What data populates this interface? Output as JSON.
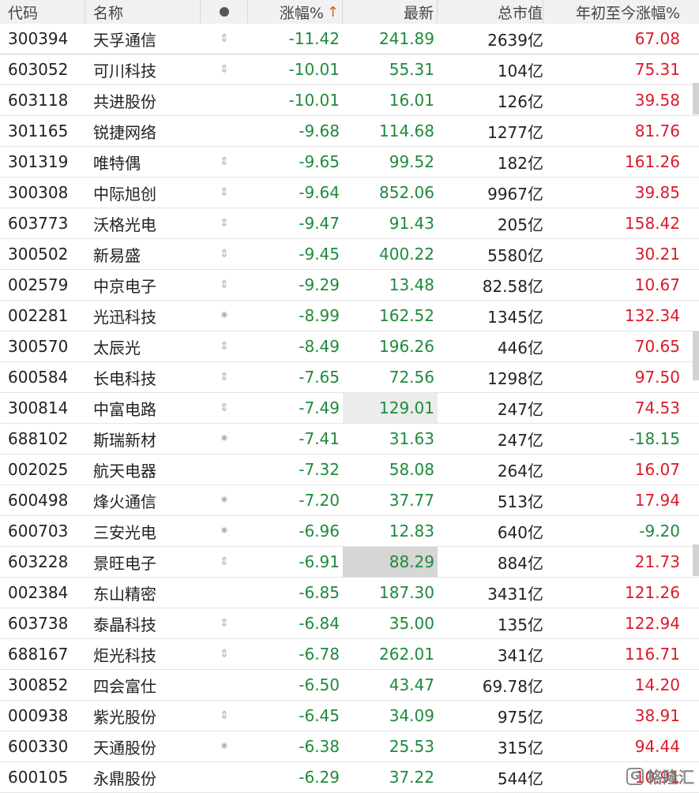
{
  "header": {
    "code": "代码",
    "name": "名称",
    "pct": "涨幅%",
    "pct_sort_arrow": "↑",
    "last": "最新",
    "cap": "总市值",
    "ytd": "年初至今涨幅%"
  },
  "colors": {
    "down": "#1e8a3a",
    "up": "#d91b2a",
    "sort_arrow": "#e0572a"
  },
  "rows": [
    {
      "code": "300394",
      "name": "天孚通信",
      "flag": "⇕",
      "pct": "-11.42",
      "last": "241.89",
      "cap": "2639亿",
      "ytd": "67.08"
    },
    {
      "code": "603052",
      "name": "可川科技",
      "flag": "⇕",
      "pct": "-10.01",
      "last": "55.31",
      "cap": "104亿",
      "ytd": "75.31"
    },
    {
      "code": "603118",
      "name": "共进股份",
      "flag": "",
      "pct": "-10.01",
      "last": "16.01",
      "cap": "126亿",
      "ytd": "39.58"
    },
    {
      "code": "301165",
      "name": "锐捷网络",
      "flag": "",
      "pct": "-9.68",
      "last": "114.68",
      "cap": "1277亿",
      "ytd": "81.76"
    },
    {
      "code": "301319",
      "name": "唯特偶",
      "flag": "⇕",
      "pct": "-9.65",
      "last": "99.52",
      "cap": "182亿",
      "ytd": "161.26"
    },
    {
      "code": "300308",
      "name": "中际旭创",
      "flag": "⇕",
      "pct": "-9.64",
      "last": "852.06",
      "cap": "9967亿",
      "ytd": "39.85"
    },
    {
      "code": "603773",
      "name": "沃格光电",
      "flag": "⇕",
      "pct": "-9.47",
      "last": "91.43",
      "cap": "205亿",
      "ytd": "158.42"
    },
    {
      "code": "300502",
      "name": "新易盛",
      "flag": "⇕",
      "pct": "-9.45",
      "last": "400.22",
      "cap": "5580亿",
      "ytd": "30.21"
    },
    {
      "code": "002579",
      "name": "中京电子",
      "flag": "⇕",
      "pct": "-9.29",
      "last": "13.48",
      "cap": "82.58亿",
      "ytd": "10.67"
    },
    {
      "code": "002281",
      "name": "光迅科技",
      "flag": "✷",
      "pct": "-8.99",
      "last": "162.52",
      "cap": "1345亿",
      "ytd": "132.34"
    },
    {
      "code": "300570",
      "name": "太辰光",
      "flag": "⇕",
      "pct": "-8.49",
      "last": "196.26",
      "cap": "446亿",
      "ytd": "70.65"
    },
    {
      "code": "600584",
      "name": "长电科技",
      "flag": "⇕",
      "pct": "-7.65",
      "last": "72.56",
      "cap": "1298亿",
      "ytd": "97.50"
    },
    {
      "code": "300814",
      "name": "中富电路",
      "flag": "⇕",
      "pct": "-7.49",
      "last": "129.01",
      "cap": "247亿",
      "ytd": "74.53"
    },
    {
      "code": "688102",
      "name": "斯瑞新材",
      "flag": "✷",
      "pct": "-7.41",
      "last": "31.63",
      "cap": "247亿",
      "ytd": "-18.15"
    },
    {
      "code": "002025",
      "name": "航天电器",
      "flag": "",
      "pct": "-7.32",
      "last": "58.08",
      "cap": "264亿",
      "ytd": "16.07"
    },
    {
      "code": "600498",
      "name": "烽火通信",
      "flag": "✷",
      "pct": "-7.20",
      "last": "37.77",
      "cap": "513亿",
      "ytd": "17.94"
    },
    {
      "code": "600703",
      "name": "三安光电",
      "flag": "✷",
      "pct": "-6.96",
      "last": "12.83",
      "cap": "640亿",
      "ytd": "-9.20"
    },
    {
      "code": "603228",
      "name": "景旺电子",
      "flag": "⇕",
      "pct": "-6.91",
      "last": "88.29",
      "cap": "884亿",
      "ytd": "21.73"
    },
    {
      "code": "002384",
      "name": "东山精密",
      "flag": "",
      "pct": "-6.85",
      "last": "187.30",
      "cap": "3431亿",
      "ytd": "121.26"
    },
    {
      "code": "603738",
      "name": "泰晶科技",
      "flag": "⇕",
      "pct": "-6.84",
      "last": "35.00",
      "cap": "135亿",
      "ytd": "122.94"
    },
    {
      "code": "688167",
      "name": "炬光科技",
      "flag": "⇕",
      "pct": "-6.78",
      "last": "262.01",
      "cap": "341亿",
      "ytd": "116.71"
    },
    {
      "code": "300852",
      "name": "四会富仕",
      "flag": "",
      "pct": "-6.50",
      "last": "43.47",
      "cap": "69.78亿",
      "ytd": "14.20"
    },
    {
      "code": "000938",
      "name": "紫光股份",
      "flag": "⇕",
      "pct": "-6.45",
      "last": "34.09",
      "cap": "975亿",
      "ytd": "38.91"
    },
    {
      "code": "600330",
      "name": "天通股份",
      "flag": "✷",
      "pct": "-6.38",
      "last": "25.53",
      "cap": "315亿",
      "ytd": "94.44"
    },
    {
      "code": "600105",
      "name": "永鼎股份",
      "flag": "",
      "pct": "-6.29",
      "last": "37.22",
      "cap": "544亿",
      "ytd": "10.91"
    }
  ],
  "watermark": {
    "text": "格隆汇",
    "logo": "G"
  }
}
